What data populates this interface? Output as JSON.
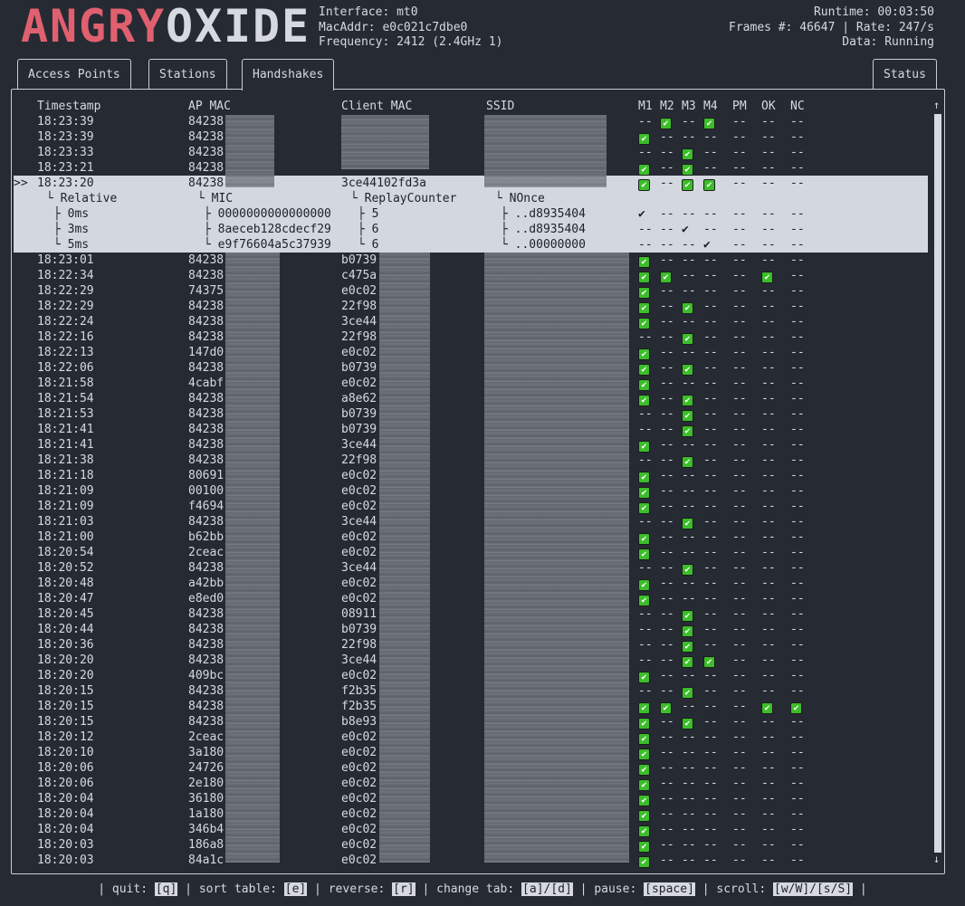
{
  "logo": "ANGRYOXIDE",
  "info_left": [
    "Interface: mt0",
    "MacAddr: e0c021c7dbe0",
    "Frequency: 2412 (2.4GHz 1)"
  ],
  "info_right": [
    "Runtime: 00:03:50",
    "Frames #: 46647 | Rate: 247/s",
    "Data: Running"
  ],
  "tabs": [
    "Access Points",
    "Stations",
    "Handshakes",
    "Status"
  ],
  "columns": [
    "Timestamp",
    "AP MAC",
    "Client MAC",
    "SSID",
    "M1",
    "M2",
    "M3",
    "M4",
    "PM",
    "OK",
    "NC"
  ],
  "rows_top": [
    {
      "ts": "18:23:39",
      "ap": "84238",
      "cl": "",
      "f": [
        0,
        1,
        0,
        1,
        0,
        0,
        0
      ]
    },
    {
      "ts": "18:23:39",
      "ap": "84238",
      "cl": "",
      "f": [
        1,
        0,
        0,
        0,
        0,
        0,
        0
      ]
    },
    {
      "ts": "18:23:33",
      "ap": "84238",
      "cl": "",
      "f": [
        0,
        0,
        1,
        0,
        0,
        0,
        0
      ]
    },
    {
      "ts": "18:23:21",
      "ap": "84238",
      "cl": "",
      "f": [
        1,
        0,
        1,
        0,
        0,
        0,
        0
      ]
    }
  ],
  "selected": {
    "marker": ">>",
    "ts": "18:23:20",
    "ap": "84238",
    "cl": "3ce44102fd3a",
    "f": [
      1,
      0,
      1,
      1,
      0,
      0,
      0
    ]
  },
  "detail_header": [
    "└ Relative",
    "└ MIC",
    "└ ReplayCounter",
    "└ NOnce"
  ],
  "detail_rows": [
    {
      "rel": "├ 0ms",
      "mic": "├ 0000000000000000",
      "rc": "├ 5",
      "nonce": "├ ..d8935404",
      "f": [
        "✔",
        "--",
        "--",
        "--",
        "--",
        "--",
        "--"
      ]
    },
    {
      "rel": "├ 3ms",
      "mic": "├ 8aeceb128cdecf29",
      "rc": "├ 6",
      "nonce": "├ ..d8935404",
      "f": [
        "--",
        "--",
        "✔",
        "--",
        "--",
        "--",
        "--"
      ]
    },
    {
      "rel": "└ 5ms",
      "mic": "└ e9f76604a5c37939",
      "rc": "└ 6",
      "nonce": "└ ..00000000",
      "f": [
        "--",
        "--",
        "--",
        "✔",
        "--",
        "--",
        "--"
      ]
    }
  ],
  "rows_bottom": [
    {
      "ts": "18:23:01",
      "ap": "84238",
      "cl": "b0739",
      "f": [
        1,
        0,
        0,
        0,
        0,
        0,
        0
      ]
    },
    {
      "ts": "18:22:34",
      "ap": "84238",
      "cl": "c475a",
      "f": [
        1,
        1,
        0,
        0,
        0,
        1,
        0
      ]
    },
    {
      "ts": "18:22:29",
      "ap": "74375",
      "cl": "e0c02",
      "f": [
        1,
        0,
        0,
        0,
        0,
        0,
        0
      ]
    },
    {
      "ts": "18:22:29",
      "ap": "84238",
      "cl": "22f98",
      "f": [
        1,
        0,
        1,
        0,
        0,
        0,
        0
      ]
    },
    {
      "ts": "18:22:24",
      "ap": "84238",
      "cl": "3ce44",
      "f": [
        1,
        0,
        0,
        0,
        0,
        0,
        0
      ]
    },
    {
      "ts": "18:22:16",
      "ap": "84238",
      "cl": "22f98",
      "f": [
        0,
        0,
        1,
        0,
        0,
        0,
        0
      ]
    },
    {
      "ts": "18:22:13",
      "ap": "147d0",
      "cl": "e0c02",
      "f": [
        1,
        0,
        0,
        0,
        0,
        0,
        0
      ]
    },
    {
      "ts": "18:22:06",
      "ap": "84238",
      "cl": "b0739",
      "f": [
        1,
        0,
        1,
        0,
        0,
        0,
        0
      ]
    },
    {
      "ts": "18:21:58",
      "ap": "4cabf",
      "cl": "e0c02",
      "f": [
        1,
        0,
        0,
        0,
        0,
        0,
        0
      ]
    },
    {
      "ts": "18:21:54",
      "ap": "84238",
      "cl": "a8e62",
      "f": [
        1,
        0,
        1,
        0,
        0,
        0,
        0
      ]
    },
    {
      "ts": "18:21:53",
      "ap": "84238",
      "cl": "b0739",
      "f": [
        0,
        0,
        1,
        0,
        0,
        0,
        0
      ]
    },
    {
      "ts": "18:21:41",
      "ap": "84238",
      "cl": "b0739",
      "f": [
        0,
        0,
        1,
        0,
        0,
        0,
        0
      ]
    },
    {
      "ts": "18:21:41",
      "ap": "84238",
      "cl": "3ce44",
      "f": [
        1,
        0,
        0,
        0,
        0,
        0,
        0
      ]
    },
    {
      "ts": "18:21:38",
      "ap": "84238",
      "cl": "22f98",
      "f": [
        0,
        0,
        1,
        0,
        0,
        0,
        0
      ]
    },
    {
      "ts": "18:21:18",
      "ap": "80691",
      "cl": "e0c02",
      "f": [
        1,
        0,
        0,
        0,
        0,
        0,
        0
      ]
    },
    {
      "ts": "18:21:09",
      "ap": "00100",
      "cl": "e0c02",
      "f": [
        1,
        0,
        0,
        0,
        0,
        0,
        0
      ]
    },
    {
      "ts": "18:21:09",
      "ap": "f4694",
      "cl": "e0c02",
      "f": [
        1,
        0,
        0,
        0,
        0,
        0,
        0
      ]
    },
    {
      "ts": "18:21:03",
      "ap": "84238",
      "cl": "3ce44",
      "f": [
        0,
        0,
        1,
        0,
        0,
        0,
        0
      ]
    },
    {
      "ts": "18:21:00",
      "ap": "b62bb",
      "cl": "e0c02",
      "f": [
        1,
        0,
        0,
        0,
        0,
        0,
        0
      ]
    },
    {
      "ts": "18:20:54",
      "ap": "2ceac",
      "cl": "e0c02",
      "f": [
        1,
        0,
        0,
        0,
        0,
        0,
        0
      ]
    },
    {
      "ts": "18:20:52",
      "ap": "84238",
      "cl": "3ce44",
      "f": [
        0,
        0,
        1,
        0,
        0,
        0,
        0
      ]
    },
    {
      "ts": "18:20:48",
      "ap": "a42bb",
      "cl": "e0c02",
      "f": [
        1,
        0,
        0,
        0,
        0,
        0,
        0
      ]
    },
    {
      "ts": "18:20:47",
      "ap": "e8ed0",
      "cl": "e0c02",
      "f": [
        1,
        0,
        0,
        0,
        0,
        0,
        0
      ]
    },
    {
      "ts": "18:20:45",
      "ap": "84238",
      "cl": "08911",
      "f": [
        0,
        0,
        1,
        0,
        0,
        0,
        0
      ]
    },
    {
      "ts": "18:20:44",
      "ap": "84238",
      "cl": "b0739",
      "f": [
        0,
        0,
        1,
        0,
        0,
        0,
        0
      ]
    },
    {
      "ts": "18:20:36",
      "ap": "84238",
      "cl": "22f98",
      "f": [
        0,
        0,
        1,
        0,
        0,
        0,
        0
      ]
    },
    {
      "ts": "18:20:20",
      "ap": "84238",
      "cl": "3ce44",
      "f": [
        0,
        0,
        1,
        1,
        0,
        0,
        0
      ]
    },
    {
      "ts": "18:20:20",
      "ap": "409bc",
      "cl": "e0c02",
      "f": [
        1,
        0,
        0,
        0,
        0,
        0,
        0
      ]
    },
    {
      "ts": "18:20:15",
      "ap": "84238",
      "cl": "f2b35",
      "f": [
        0,
        0,
        1,
        0,
        0,
        0,
        0
      ]
    },
    {
      "ts": "18:20:15",
      "ap": "84238",
      "cl": "f2b35",
      "f": [
        1,
        1,
        0,
        0,
        0,
        1,
        1
      ]
    },
    {
      "ts": "18:20:15",
      "ap": "84238",
      "cl": "b8e93",
      "f": [
        1,
        0,
        1,
        0,
        0,
        0,
        0
      ]
    },
    {
      "ts": "18:20:12",
      "ap": "2ceac",
      "cl": "e0c02",
      "f": [
        1,
        0,
        0,
        0,
        0,
        0,
        0
      ]
    },
    {
      "ts": "18:20:10",
      "ap": "3a180",
      "cl": "e0c02",
      "f": [
        1,
        0,
        0,
        0,
        0,
        0,
        0
      ]
    },
    {
      "ts": "18:20:06",
      "ap": "24726",
      "cl": "e0c02",
      "f": [
        1,
        0,
        0,
        0,
        0,
        0,
        0
      ]
    },
    {
      "ts": "18:20:06",
      "ap": "2e180",
      "cl": "e0c02",
      "f": [
        1,
        0,
        0,
        0,
        0,
        0,
        0
      ]
    },
    {
      "ts": "18:20:04",
      "ap": "36180",
      "cl": "e0c02",
      "f": [
        1,
        0,
        0,
        0,
        0,
        0,
        0
      ]
    },
    {
      "ts": "18:20:04",
      "ap": "1a180",
      "cl": "e0c02",
      "f": [
        1,
        0,
        0,
        0,
        0,
        0,
        0
      ]
    },
    {
      "ts": "18:20:04",
      "ap": "346b4",
      "cl": "e0c02",
      "f": [
        1,
        0,
        0,
        0,
        0,
        0,
        0
      ]
    },
    {
      "ts": "18:20:03",
      "ap": "186a8",
      "cl": "e0c02",
      "f": [
        1,
        0,
        0,
        0,
        0,
        0,
        0
      ]
    },
    {
      "ts": "18:20:03",
      "ap": "84a1c",
      "cl": "e0c02",
      "f": [
        1,
        0,
        0,
        0,
        0,
        0,
        0
      ]
    }
  ],
  "footer": [
    {
      "text": "| quit: ",
      "key": "[q]"
    },
    {
      "text": " | sort table: ",
      "key": "[e]"
    },
    {
      "text": " | reverse: ",
      "key": "[r]"
    },
    {
      "text": " | change tab: ",
      "key": "[a]/[d]"
    },
    {
      "text": " | pause: ",
      "key": "[space]"
    },
    {
      "text": " | scroll: ",
      "key": "[w/W]/[s/S]"
    },
    {
      "text": " |",
      "key": ""
    }
  ],
  "scroll_up": "↑",
  "scroll_down": "↓",
  "colors": {
    "bg": "#262a33",
    "logo_red": "#e06070",
    "logo_light": "#d6dae0",
    "check": "#3cbd2a",
    "highlight": "#d3d7df"
  }
}
